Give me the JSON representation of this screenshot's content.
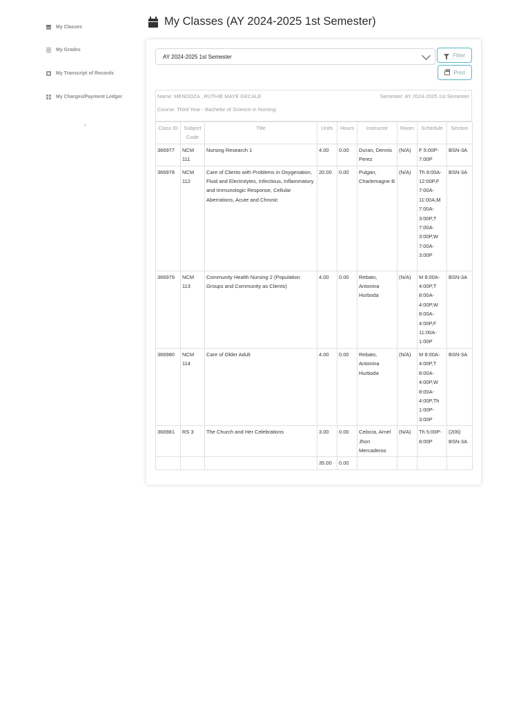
{
  "sidebar": {
    "items": [
      {
        "label": "My Classes",
        "icon": "calendar-icon"
      },
      {
        "label": "My Grades",
        "icon": "list-icon"
      },
      {
        "label": "My Transcript of Records",
        "icon": "document-icon"
      },
      {
        "label": "My Charges/Payment Ledger",
        "icon": "grid-icon"
      }
    ],
    "collapse_glyph": "‹"
  },
  "header": {
    "title": "My Classes (AY 2024-2025 1st Semester)",
    "icon": "calendar-icon"
  },
  "filter": {
    "selected": "AY 2024-2025 1st Semester",
    "filter_label": "Filter",
    "print_label": "Print",
    "accent_color": "#56b5c4"
  },
  "student": {
    "name": "Name: MENDOZA , RUTHIE MAYE GECALE",
    "semester": "Semester: AY 2024-2025 1st Semester",
    "course": "Course: Third Year - Bachelor of Science in Nursing"
  },
  "table": {
    "headers": [
      "Class ID",
      "Subject Code",
      "Title",
      "Units",
      "Hours",
      "Instructor",
      "Room",
      "Schedule",
      "Section"
    ],
    "rows": [
      {
        "class_id": "366977",
        "subject_code": "NCM 111",
        "title": "Nursing Research 1",
        "units": "4.00",
        "hours": "0.00",
        "instructor": "Duran, Dennis Perez",
        "room": "(N/A)",
        "schedule": "F 5:00P-7:00P",
        "section": "BSN-3A"
      },
      {
        "class_id": "366978",
        "subject_code": "NCM 112",
        "title": "Care of Clients with Problems in Oxygenation, Fluid and Electrolytes, Infectious, Inflammatory and Immunologic Response, Cellular Aberrations, Acute and Chronic",
        "units": "20.00",
        "hours": "0.00",
        "instructor": "Pulgan, Charlemagne B",
        "room": "(N/A)",
        "schedule": "Th 8:00A-12:00P,F 7:00A-11:00A,M 7:00A-3:00P,T 7:00A-3:00P,W 7:00A-3:00P",
        "section": "BSN-3A"
      },
      {
        "class_id": "366979",
        "subject_code": "NCM 113",
        "title": "Community Health Nursing 2 (Population Groups and Community as Clients)",
        "units": "4.00",
        "hours": "0.00",
        "instructor": "Rebato, Antonina Hurboda",
        "room": "(N/A)",
        "schedule": "M 8:00A-4:00P,T 8:00A-4:00P,W 8:00A-4:00P,F 11:00A-1:00P",
        "section": "BSN-3A"
      },
      {
        "class_id": "366980",
        "subject_code": "NCM 114",
        "title": "Care of Older Adult",
        "units": "4.00",
        "hours": "0.00",
        "instructor": "Rebato, Antonina Hurboda",
        "room": "(N/A)",
        "schedule": "M 8:00A-4:00P,T 8:00A-4:00P,W 8:00A-4:00P,Th 1:00P-3:00P",
        "section": "BSN-3A"
      },
      {
        "class_id": "366981",
        "subject_code": "RS 3",
        "title": "The Church and Her Celebrations",
        "units": "3.00",
        "hours": "0.00",
        "instructor": "Celocia, Arnel Jhon Mercaderos",
        "room": "(N/A)",
        "schedule": "Th 5:00P-8:00P",
        "section": "(206) BSN-3A"
      }
    ],
    "totals": {
      "units": "35.00",
      "hours": "0.00"
    }
  }
}
